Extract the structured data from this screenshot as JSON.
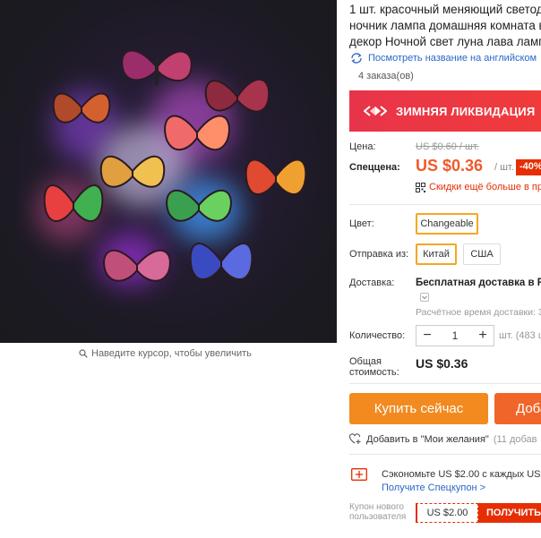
{
  "product": {
    "title_lines": [
      "1 шт. красочный меняющий светод",
      "ночник лампа домашняя комната в",
      "декор Ночной свет луна лава лампа"
    ],
    "translate_link": "Посмотреть название на английском",
    "orders": "4 заказа(ов)",
    "image_hint": "Наведите курсор, чтобы увеличить"
  },
  "sale_banner": {
    "text": "ЗИМНЯЯ ЛИКВИДАЦИЯ"
  },
  "pricing": {
    "price_label": "Цена:",
    "old_price": "US $0.60 / шт.",
    "special_label": "Спеццена:",
    "price": "US $0.36",
    "per_unit": "/ шт.",
    "discount": "-40%",
    "coupon_more": "Скидки ещё больше в при"
  },
  "options": {
    "color_label": "Цвет:",
    "color_value": "Changeable",
    "ship_from_label": "Отправка из:",
    "ship_from_options": [
      "Китай",
      "США"
    ],
    "ship_from_selected": "Китай"
  },
  "delivery": {
    "label": "Доставка:",
    "value": "Бесплатная доставка в Rus",
    "eta": "Расчётное время доставки: 3"
  },
  "quantity": {
    "label": "Количество:",
    "value": "1",
    "minus": "−",
    "plus": "+",
    "available": "шт. (483 ш"
  },
  "total": {
    "label_line1": "Общая",
    "label_line2": "стоимость:",
    "value": "US $0.36"
  },
  "actions": {
    "buy_now": "Купить сейчас",
    "add_to_cart": "Доба",
    "wishlist": "Добавить в \"Мои желания\"",
    "wishlist_count": "(11 добав"
  },
  "promo": {
    "save_text": "Сэкономьте US $2.00 с каждых US $1",
    "spec_coupon_link": "Получите Спецкупон >",
    "newbie_label_line1": "Купон нового",
    "newbie_label_line2": "пользователя",
    "coupon_value": "US $2.00",
    "get_button": "ПОЛУЧИТЬ"
  },
  "colors": {
    "accent_orange": "#f28a20",
    "price_red": "#f05a2a",
    "sale_red": "#e8344a",
    "link_blue": "#2a67c8",
    "option_border": "#f5a623"
  },
  "icons": [
    "search-icon",
    "translate-icon",
    "chevron-down-icon",
    "coupon-icon",
    "heart-plus-icon",
    "ticket-icon",
    "sale-arrows-icon"
  ]
}
